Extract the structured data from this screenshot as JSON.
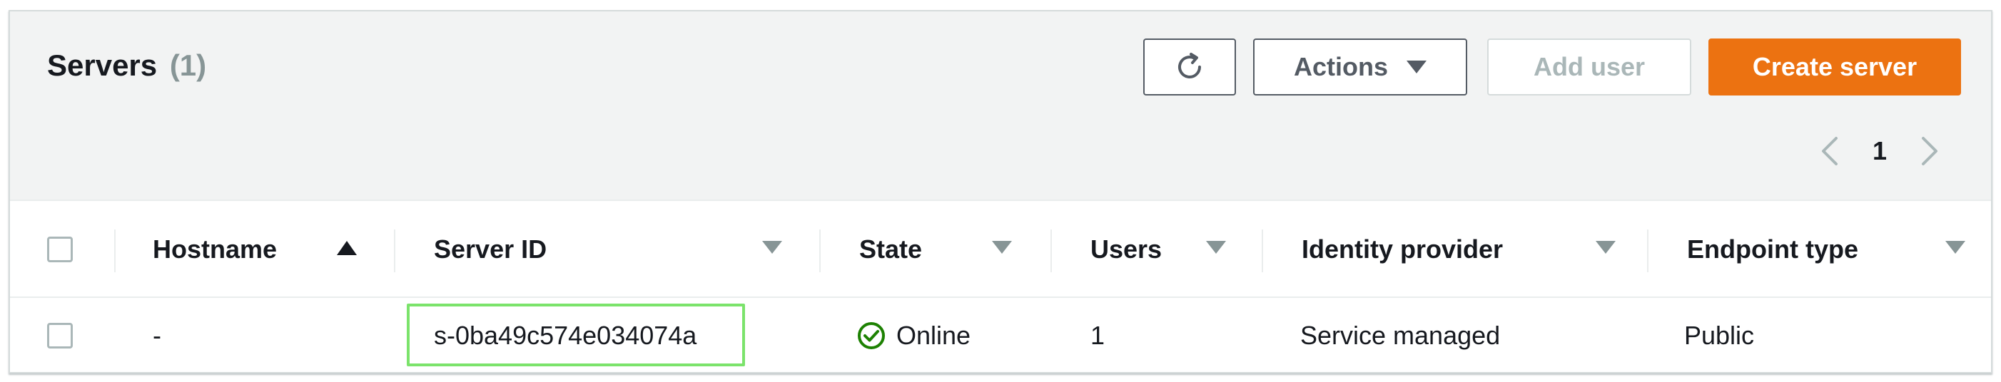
{
  "header": {
    "title": "Servers",
    "count": "(1)"
  },
  "toolbar": {
    "actions_label": "Actions",
    "add_user_label": "Add user",
    "create_server_label": "Create server"
  },
  "pagination": {
    "current_page": "1"
  },
  "table": {
    "columns": [
      "Hostname",
      "Server ID",
      "State",
      "Users",
      "Identity provider",
      "Endpoint type"
    ],
    "rows": [
      {
        "hostname": "-",
        "server_id": "s-0ba49c574e034074a",
        "state": "Online",
        "users": "1",
        "identity_provider": "Service managed",
        "endpoint_type": "Public"
      }
    ]
  },
  "colors": {
    "accent": "#ec7211",
    "link": "#0073bb",
    "success": "#1d8102",
    "highlight": "#7be36b"
  },
  "icons": {
    "refresh": "refresh-icon",
    "sort_asc": "sort-ascending-icon",
    "sort_desc": "sort-descending-icon",
    "status_ok": "check-circle-icon"
  }
}
